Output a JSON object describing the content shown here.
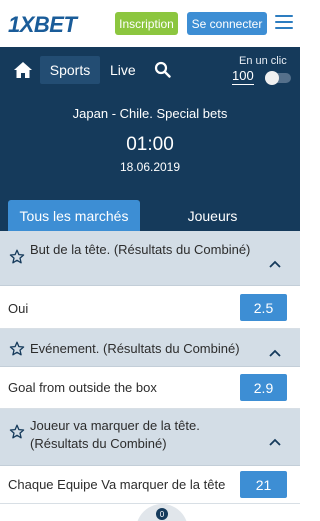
{
  "header": {
    "logo_text": "1XBET",
    "signup_label": "Inscription",
    "login_label": "Se connecter",
    "menu_icon": "hamburger-menu-icon",
    "colors": {
      "brand": "#1a5c99",
      "signup": "#8cc63f",
      "login": "#3d8ed4"
    }
  },
  "nav": {
    "home_icon": "home-icon",
    "sports_label": "Sports",
    "live_label": "Live",
    "search_icon": "search-icon",
    "one_click_label": "En un clic",
    "one_click_value": "100",
    "one_click_enabled": false,
    "colors": {
      "background": "#153a5b",
      "active_tab": "#234d73"
    }
  },
  "match": {
    "title": "Japan - Chile. Special bets",
    "time": "01:00",
    "date": "18.06.2019"
  },
  "tabs": {
    "all_markets": "Tous les marchés",
    "players": "Joueurs",
    "active": "all_markets"
  },
  "markets": [
    {
      "title": "But de la tête. (Résultats du Combiné)",
      "outcomes": [
        {
          "label": "Oui",
          "odds": "2.5"
        }
      ]
    },
    {
      "title": "Evénement. (Résultats du Combiné)",
      "outcomes": [
        {
          "label": "Goal from outside the box",
          "odds": "2.9"
        }
      ]
    },
    {
      "title": "Joueur va marquer de la tête. (Résultats du Combiné)",
      "outcomes": [
        {
          "label": "Chaque Equipe Va marquer de la tête",
          "odds": "21"
        }
      ]
    }
  ],
  "betslip": {
    "count": "0"
  }
}
